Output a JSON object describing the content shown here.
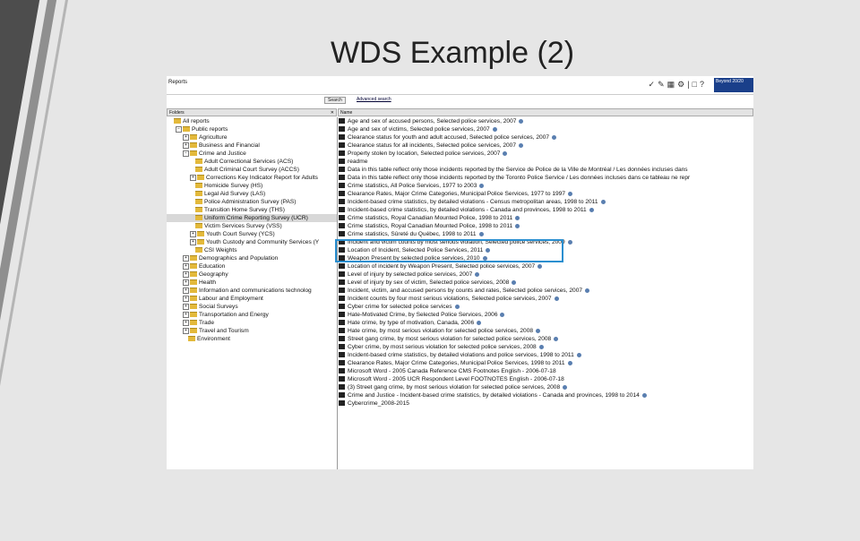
{
  "slide_title": "WDS Example (2)",
  "reports_tab": "Reports",
  "brand_text": "Beyond 20/20",
  "search_label": "Search",
  "advanced_search": "Advanced search",
  "left_header": "Folders",
  "right_header": "Name",
  "tree": [
    {
      "label": "All reports",
      "indent": 0,
      "exp": "",
      "folder": true
    },
    {
      "label": "Public reports",
      "indent": 1,
      "exp": "−",
      "folder": true
    },
    {
      "label": "Agriculture",
      "indent": 2,
      "exp": "+",
      "folder": true
    },
    {
      "label": "Business and Financial",
      "indent": 2,
      "exp": "+",
      "folder": true
    },
    {
      "label": "Crime and Justice",
      "indent": 2,
      "exp": "−",
      "folder": true
    },
    {
      "label": "Adult Correctional Services (ACS)",
      "indent": 3,
      "exp": "",
      "folder": true
    },
    {
      "label": "Adult Criminal Court Survey (ACCS)",
      "indent": 3,
      "exp": "",
      "folder": true
    },
    {
      "label": "Corrections Key Indicator Report for Adults",
      "indent": 3,
      "exp": "+",
      "folder": true
    },
    {
      "label": "Homicide Survey (HS)",
      "indent": 3,
      "exp": "",
      "folder": true
    },
    {
      "label": "Legal Aid Survey (LAS)",
      "indent": 3,
      "exp": "",
      "folder": true
    },
    {
      "label": "Police Administration Survey (PAS)",
      "indent": 3,
      "exp": "",
      "folder": true
    },
    {
      "label": "Transition Home Survey (THS)",
      "indent": 3,
      "exp": "",
      "folder": true
    },
    {
      "label": "Uniform Crime Reporting Survey (UCR)",
      "indent": 3,
      "exp": "",
      "folder": true,
      "selected": true
    },
    {
      "label": "Victim Services Survey (VSS)",
      "indent": 3,
      "exp": "",
      "folder": true
    },
    {
      "label": "Youth Court Survey (YCS)",
      "indent": 3,
      "exp": "+",
      "folder": true
    },
    {
      "label": "Youth Custody and Community Services (Y",
      "indent": 3,
      "exp": "+",
      "folder": true
    },
    {
      "label": "CSI Weights",
      "indent": 3,
      "exp": "",
      "folder": true
    },
    {
      "label": "Demographics and Population",
      "indent": 2,
      "exp": "+",
      "folder": true
    },
    {
      "label": "Education",
      "indent": 2,
      "exp": "+",
      "folder": true
    },
    {
      "label": "Geography",
      "indent": 2,
      "exp": "+",
      "folder": true
    },
    {
      "label": "Health",
      "indent": 2,
      "exp": "+",
      "folder": true
    },
    {
      "label": "Information and communications technolog",
      "indent": 2,
      "exp": "+",
      "folder": true
    },
    {
      "label": "Labour and Employment",
      "indent": 2,
      "exp": "+",
      "folder": true
    },
    {
      "label": "Social Surveys",
      "indent": 2,
      "exp": "+",
      "folder": true
    },
    {
      "label": "Transportation and Energy",
      "indent": 2,
      "exp": "+",
      "folder": true
    },
    {
      "label": "Trade",
      "indent": 2,
      "exp": "+",
      "folder": true
    },
    {
      "label": "Travel and Tourism",
      "indent": 2,
      "exp": "+",
      "folder": true
    },
    {
      "label": "Environment",
      "indent": 2,
      "exp": "",
      "folder": true
    }
  ],
  "files": [
    {
      "label": "Age and sex of accused persons, Selected police services, 2007",
      "info": true
    },
    {
      "label": "Age and sex of victims, Selected police services, 2007",
      "info": true
    },
    {
      "label": "Clearance status for youth and adult accused, Selected police services, 2007",
      "info": true
    },
    {
      "label": "Clearance status for all incidents, Selected police services, 2007",
      "info": true
    },
    {
      "label": "Property stolen by location, Selected police services, 2007",
      "info": true
    },
    {
      "label": "readme",
      "info": false
    },
    {
      "label": "Data in this table reflect only those incidents reported by the Service de Police de la Ville de Montréal / Les données incluses dans",
      "info": false
    },
    {
      "label": "Data in this table reflect only those incidents reported by the Toronto Police Service / Les données incluses dans ce tableau ne repr",
      "info": false
    },
    {
      "label": "Crime statistics, All Police Services, 1977 to 2003",
      "info": true
    },
    {
      "label": "Clearance Rates, Major Crime Categories, Municipal Police Services, 1977 to 1997",
      "info": true
    },
    {
      "label": "Incident-based crime statistics, by detailed violations - Census metropolitan areas, 1998 to 2011",
      "info": true
    },
    {
      "label": "Incident-based crime statistics, by detailed violations - Canada and provinces, 1998 to 2011",
      "info": true
    },
    {
      "label": "Crime statistics, Royal Canadian Mounted Police, 1998 to 2011",
      "info": true
    },
    {
      "label": "Crime statistics, Royal Canadian Mounted Police, 1998 to 2011",
      "info": true
    },
    {
      "label": "Crime statistics, Sûreté du Québec, 1998 to 2011",
      "info": true
    },
    {
      "label": "Incident and victim counts by most serious violation, Selected police services, 2009",
      "info": true
    },
    {
      "label": "Location of Incident, Selected Police Services, 2011",
      "info": true
    },
    {
      "label": "Weapon Present by selected police services, 2010",
      "info": true
    },
    {
      "label": "Location of incident by Weapon Present, Selected police services, 2007",
      "info": true
    },
    {
      "label": "Level of injury by selected police services, 2007",
      "info": true
    },
    {
      "label": "Level of injury by sex of victim, Selected police services, 2008",
      "info": true
    },
    {
      "label": "Incident, victim, and accused persons by counts and rates, Selected police services, 2007",
      "info": true
    },
    {
      "label": "Incident counts by four most serious violations, Selected police services, 2007",
      "info": true
    },
    {
      "label": "Cyber crime for selected police services",
      "info": true
    },
    {
      "label": "Hate-Motivated Crime, by Selected Police Services, 2006",
      "info": true
    },
    {
      "label": "Hate crime, by type of motivation, Canada, 2006",
      "info": true
    },
    {
      "label": "Hate crime, by most serious violation for selected police services, 2008",
      "info": true
    },
    {
      "label": "Street gang crime, by most serious violation for selected police services, 2008",
      "info": true
    },
    {
      "label": "Cyber crime, by most serious violation for selected police services, 2008",
      "info": true
    },
    {
      "label": "Incident-based crime statistics, by detailed violations and police services, 1998 to 2011",
      "info": true
    },
    {
      "label": "Clearance Rates, Major Crime Categories, Municipal Police Services, 1998 to 2011",
      "info": true
    },
    {
      "label": "Microsoft Word - 2005 Canada Reference CMS Footnotes English - 2006-07-18",
      "info": false
    },
    {
      "label": "Microsoft Word - 2005 UCR Respondent Level FOOTNOTES English - 2006-07-18",
      "info": false
    },
    {
      "label": "(3) Street gang crime, by most serious violation for selected police services, 2008",
      "info": true
    },
    {
      "label": "Crime and Justice - Incident-based crime statistics, by detailed violations - Canada and provinces, 1998 to 2014",
      "info": true
    },
    {
      "label": "Cybercrime_2008-2015",
      "info": false
    }
  ]
}
